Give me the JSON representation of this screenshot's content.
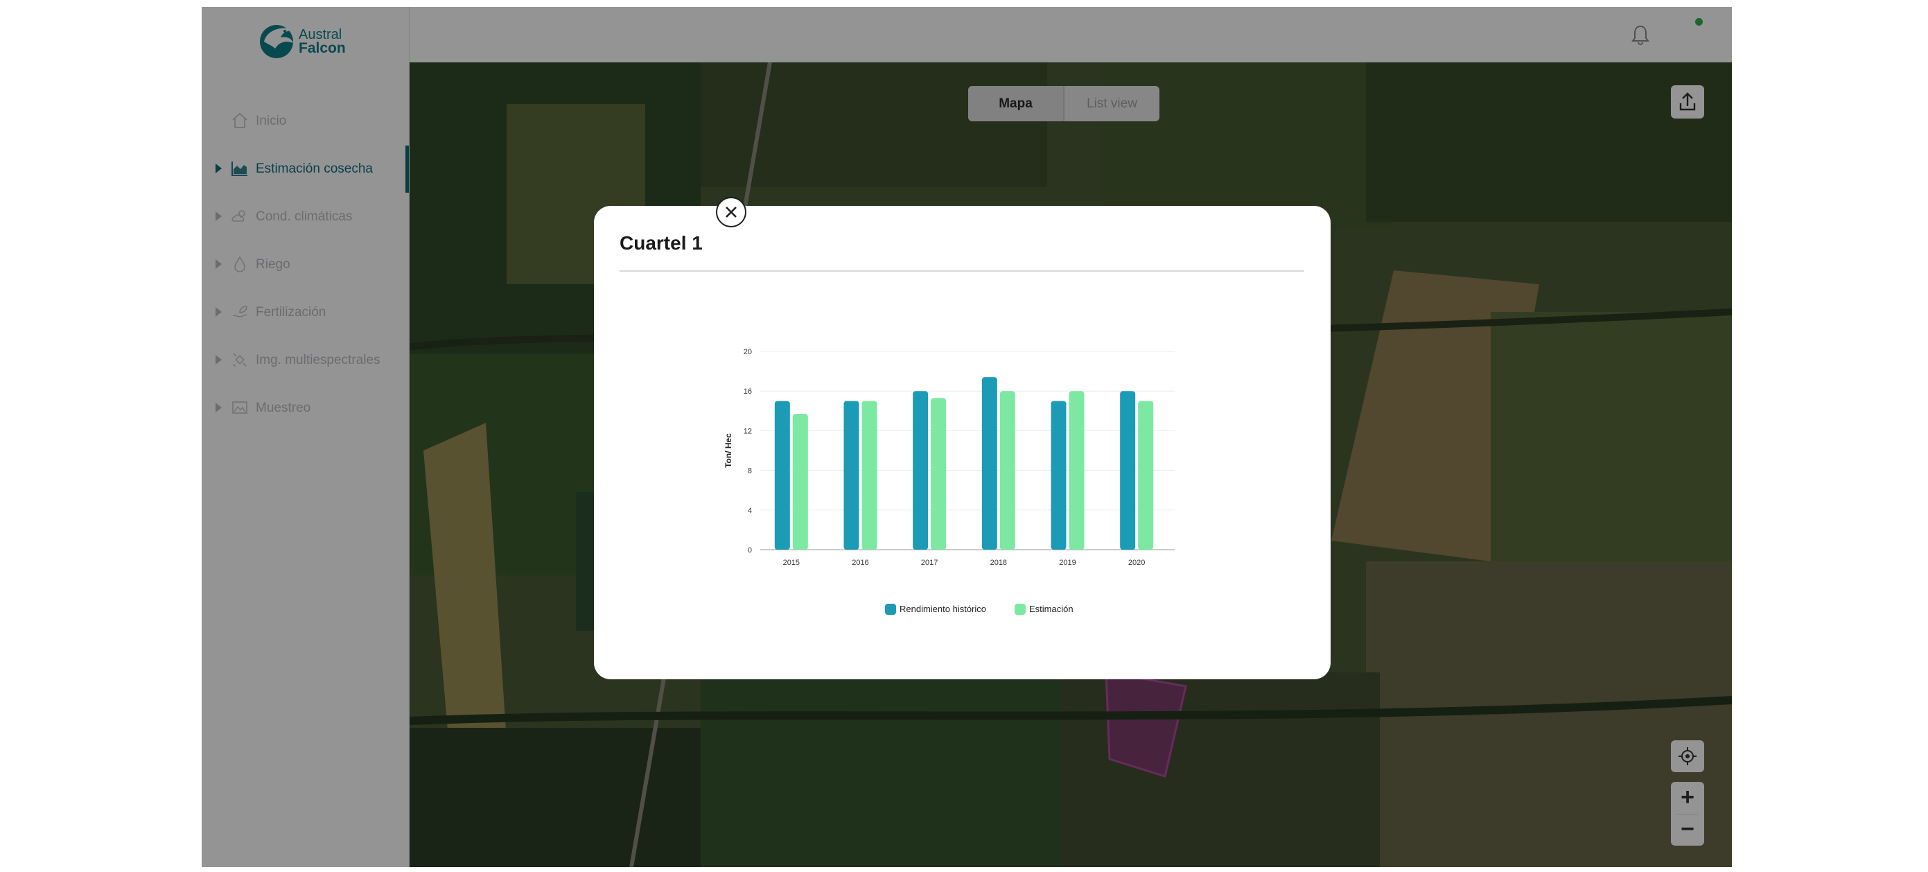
{
  "brand": {
    "line1": "Austral",
    "line2": "Falcon"
  },
  "sidebar": {
    "items": [
      {
        "label": "Inicio",
        "icon": "home-icon",
        "active": false,
        "expandable": false
      },
      {
        "label": "Estimación cosecha",
        "icon": "area-chart-icon",
        "active": true,
        "expandable": true
      },
      {
        "label": "Cond. climáticas",
        "icon": "cloud-sun-icon",
        "active": false,
        "expandable": true
      },
      {
        "label": "Riego",
        "icon": "water-drop-icon",
        "active": false,
        "expandable": true
      },
      {
        "label": "Fertilización",
        "icon": "leaf-hand-icon",
        "active": false,
        "expandable": true
      },
      {
        "label": "Img. multiespectrales",
        "icon": "satellite-icon",
        "active": false,
        "expandable": true
      },
      {
        "label": "Muestreo",
        "icon": "sample-image-icon",
        "active": false,
        "expandable": true
      }
    ]
  },
  "topbar": {
    "notification_icon": "bell-icon",
    "status_color": "#2ab34a"
  },
  "map": {
    "view_toggle": {
      "selected": "Mapa",
      "other": "List view"
    },
    "upload_icon": "upload-icon",
    "locate_icon": "crosshair-icon",
    "zoom_in_label": "+",
    "zoom_out_label": "−"
  },
  "modal": {
    "title": "Cuartel 1",
    "close_icon": "close-icon"
  },
  "colors": {
    "accent": "#0f6d7a",
    "series1": "#1b9bb6",
    "series2": "#7de8a1"
  },
  "chart_data": {
    "type": "bar",
    "title": "",
    "xlabel": "",
    "ylabel": "Ton/ Hec",
    "categories": [
      "2015",
      "2016",
      "2017",
      "2018",
      "2019",
      "2020"
    ],
    "series": [
      {
        "name": "Rendimiento histórico",
        "color": "#1b9bb6",
        "values": [
          15,
          15,
          16,
          17.4,
          15,
          16
        ]
      },
      {
        "name": "Estimación",
        "color": "#7de8a1",
        "values": [
          13.7,
          15,
          15.3,
          16,
          16,
          15
        ]
      }
    ],
    "ylim": [
      0,
      20
    ],
    "yticks": [
      0,
      4,
      8,
      12,
      16,
      20
    ],
    "grid": true,
    "legend_position": "bottom"
  }
}
